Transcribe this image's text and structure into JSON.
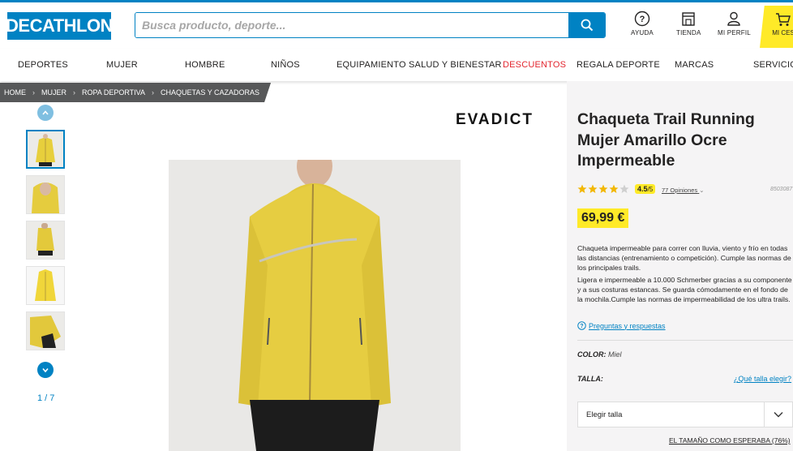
{
  "header": {
    "logo_text": "DECATHLON",
    "search_placeholder": "Busca producto, deporte...",
    "icons": [
      {
        "name": "help-icon",
        "label": "AYUDA"
      },
      {
        "name": "store-icon",
        "label": "TIENDA"
      },
      {
        "name": "user-icon",
        "label": "MI PERFIL"
      }
    ],
    "cart_label": "MI CES"
  },
  "nav": {
    "items": [
      "DEPORTES",
      "MUJER",
      "HOMBRE",
      "NIÑOS",
      "EQUIPAMIENTO",
      "SALUD Y BIENESTAR",
      "DESCUENTOS",
      "REGALA DEPORTE",
      "MARCAS",
      "SERVICIOS"
    ]
  },
  "breadcrumb": [
    "HOME",
    "MUJER",
    "ROPA DEPORTIVA",
    "CHAQUETAS Y CAZADORAS"
  ],
  "gallery": {
    "counter": "1 / 7"
  },
  "product": {
    "brand": "EVADICT",
    "title": "Chaqueta Trail Running Mujer Amarillo Ocre Impermeable",
    "rating": "4.5",
    "rating_max": "/5",
    "reviews": "77 Opiniones",
    "ref": "8503087",
    "price": "69,99 €",
    "desc1": "Chaqueta impermeable para correr con lluvia, viento y frío en todas las distancias (entrenamiento o competición). Cumple las normas de los principales trails.",
    "desc2": "Ligera e impermeable a 10.000 Schmerber gracias a su componente y a sus costuras estancas. Se guarda cómodamente en el fondo de la mochila.Cumple las normas de impermeabilidad de los ultra trails.",
    "qa_link": "Preguntas y respuestas",
    "color_label": "COLOR:",
    "color_value": "Miel",
    "size_label": "TALLA:",
    "size_guide": "¿Qué talla elegir?",
    "size_select": "Elegir talla",
    "fit_text": "EL TAMAÑO COMO ESPERABA (76%)"
  },
  "colors": {
    "brand_blue": "#0082c3",
    "yellow": "#ffea28",
    "sale_red": "#e3262f"
  }
}
